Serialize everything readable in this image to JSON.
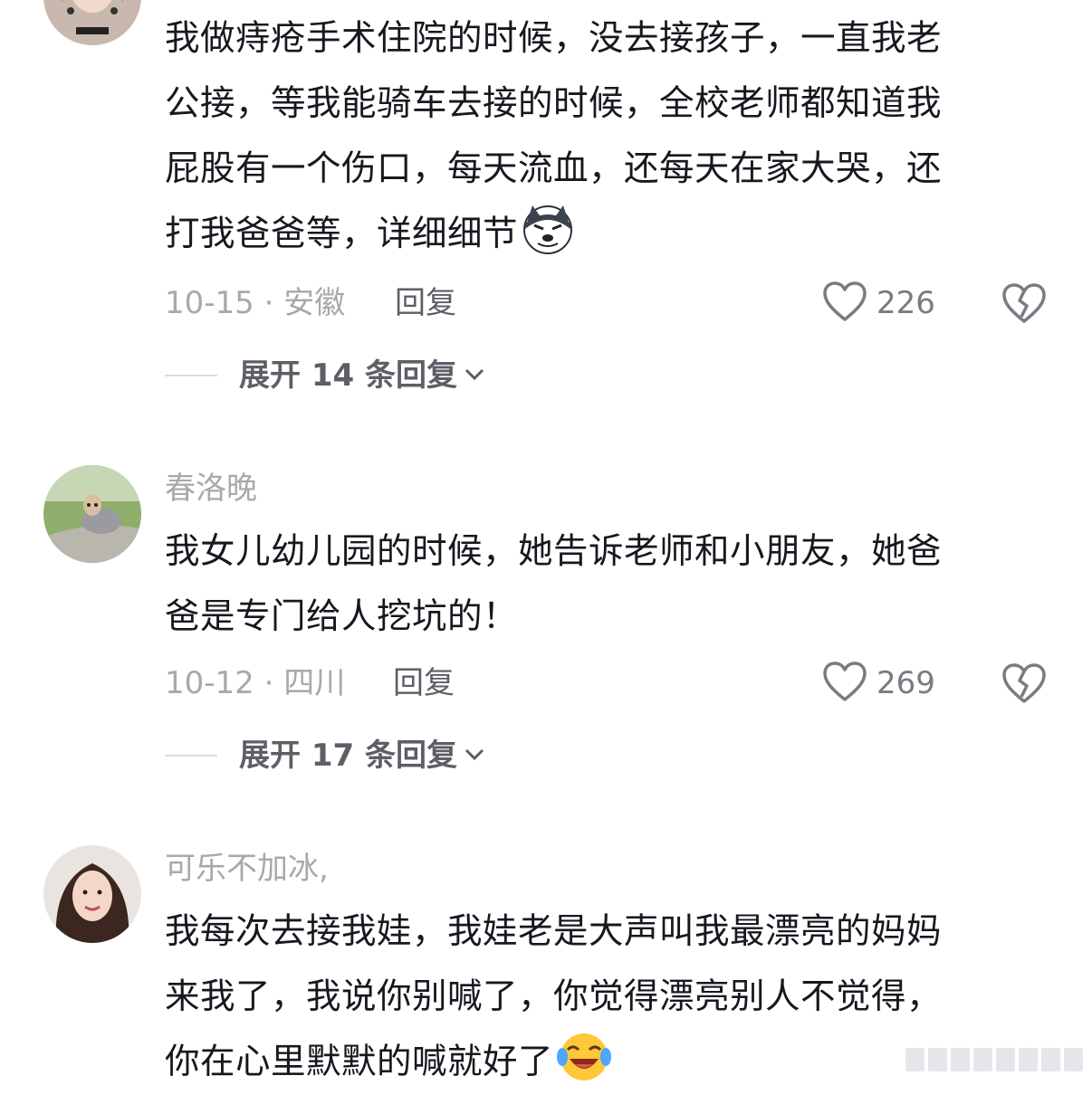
{
  "comments": [
    {
      "username": "",
      "lines": [
        "我做痔疮手术住院的时候，没去接孩子，一直我老",
        "公接，等我能骑车去接的时候，全校老师都知道我",
        "屁股有一个伤口，每天流血，还每天在家大哭，还",
        "打我爸爸等，详细细节"
      ],
      "emoji": "husky-smirk-emoji",
      "meta": "10-15 · 安徽",
      "reply_label": "回复",
      "likes": "226",
      "expand_label": "展开 14 条回复"
    },
    {
      "username": "春洛晚",
      "lines": [
        "我女儿幼儿园的时候，她告诉老师和小朋友，她爸",
        "爸是专门给人挖坑的！"
      ],
      "meta": "10-12 · 四川",
      "reply_label": "回复",
      "likes": "269",
      "expand_label": "展开 17 条回复"
    },
    {
      "username": "可乐不加冰,",
      "lines": [
        "我每次去接我娃，我娃老是大声叫我最漂亮的妈妈",
        "来我了，我说你别喊了，你觉得漂亮别人不觉得，",
        "你在心里默默的喊就好了"
      ],
      "emoji": "laughing-crying-emoji"
    }
  ],
  "colors": {
    "text": "#17181f",
    "muted": "#a8a8ad",
    "action": "#5d5e66"
  }
}
